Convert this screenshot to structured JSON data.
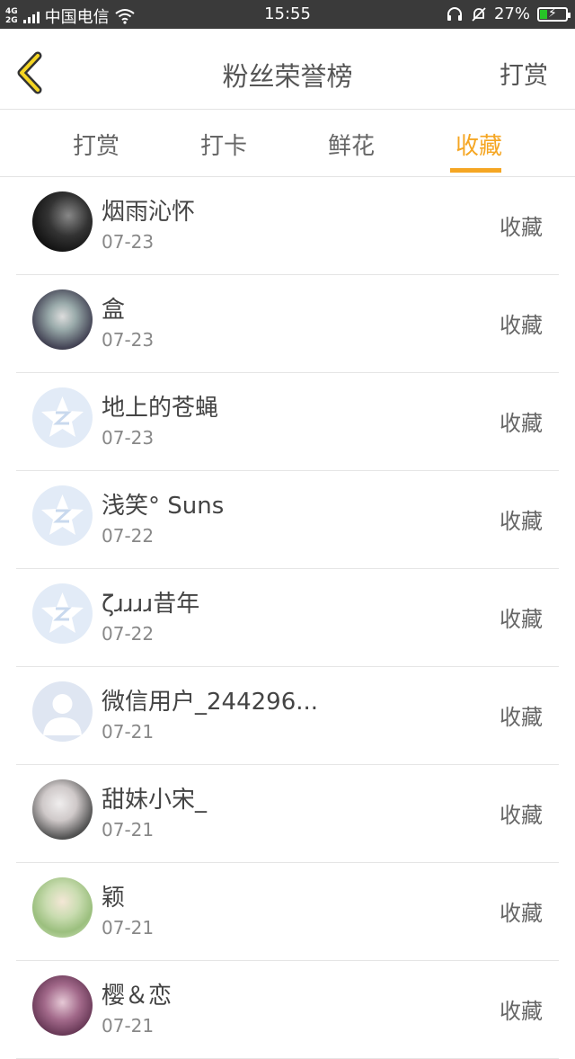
{
  "status_bar": {
    "network": "4G\n2G",
    "carrier": "中国电信",
    "time": "15:55",
    "battery": "27%",
    "battery_level": 0.27
  },
  "header": {
    "title": "粉丝荣誉榜",
    "right_action": "打赏",
    "back_icon": "chevron-left-icon",
    "accent_color": "#f5a623"
  },
  "tabs": [
    {
      "label": "打赏",
      "active": false
    },
    {
      "label": "打卡",
      "active": false
    },
    {
      "label": "鲜花",
      "active": false
    },
    {
      "label": "收藏",
      "active": true
    }
  ],
  "list": [
    {
      "name": "烟雨沁怀",
      "date": "07-23",
      "action": "收藏",
      "avatar": "dark-photo"
    },
    {
      "name": "盒",
      "date": "07-23",
      "action": "收藏",
      "avatar": "anime-photo"
    },
    {
      "name": "地上的苍蝇",
      "date": "07-23",
      "action": "收藏",
      "avatar": "default-star"
    },
    {
      "name": "浅笑° Suns",
      "date": "07-22",
      "action": "收藏",
      "avatar": "default-star"
    },
    {
      "name": "ζɹɹɹɹ昔年",
      "date": "07-22",
      "action": "收藏",
      "avatar": "default-star"
    },
    {
      "name": "微信用户_244296...",
      "date": "07-21",
      "action": "收藏",
      "avatar": "default-person"
    },
    {
      "name": "甜妹小宋_",
      "date": "07-21",
      "action": "收藏",
      "avatar": "girl-photo"
    },
    {
      "name": "颖",
      "date": "07-21",
      "action": "收藏",
      "avatar": "green-photo"
    },
    {
      "name": "樱＆恋",
      "date": "07-21",
      "action": "收藏",
      "avatar": "purple-photo"
    }
  ]
}
